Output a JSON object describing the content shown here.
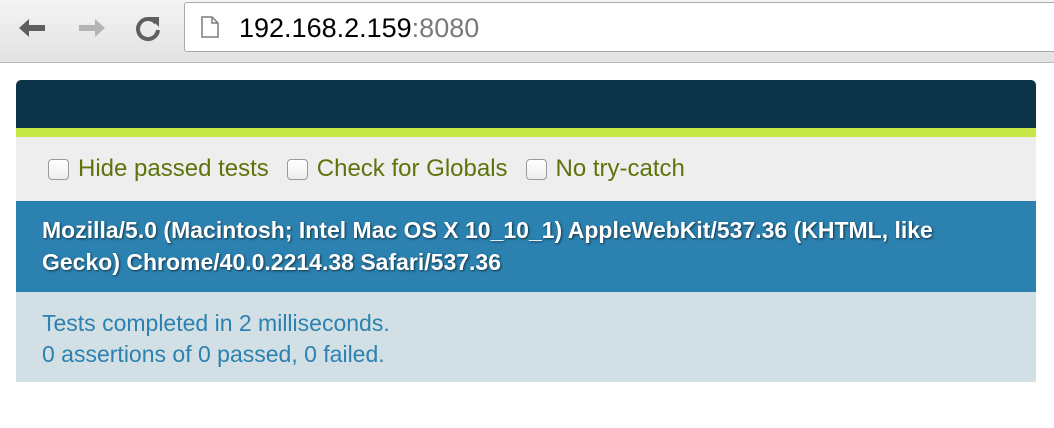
{
  "browser": {
    "url_host": "192.168.2.159",
    "url_port": ":8080",
    "icons": {
      "back": "back-arrow-icon",
      "forward": "forward-arrow-icon",
      "reload": "reload-icon",
      "page": "page-icon"
    }
  },
  "toolbar": {
    "options": [
      {
        "label": "Hide passed tests",
        "checked": false
      },
      {
        "label": "Check for Globals",
        "checked": false
      },
      {
        "label": "No try-catch",
        "checked": false
      }
    ]
  },
  "userAgent": "Mozilla/5.0 (Macintosh; Intel Mac OS X 10_10_1) AppleWebKit/537.36 (KHTML, like Gecko) Chrome/40.0.2214.38 Safari/537.36",
  "result": {
    "line1": "Tests completed in 2 milliseconds.",
    "line2": "0 assertions of 0 passed, 0 failed."
  },
  "colors": {
    "header": "#0d3349",
    "header_accent": "#c6e746",
    "banner": "#2b81af",
    "result_bg": "#d2e0e6",
    "option_text": "#5e740b"
  }
}
